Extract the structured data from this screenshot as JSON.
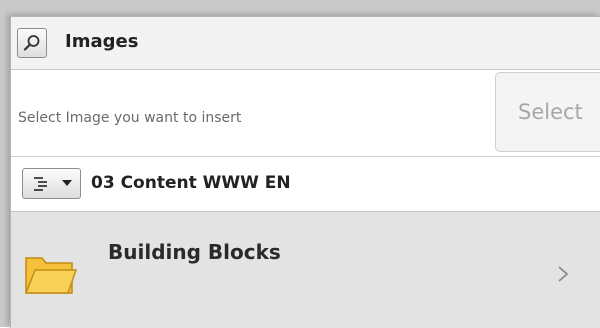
{
  "header": {
    "title": "Images",
    "search_icon": "search-icon"
  },
  "insert": {
    "hint": "Select Image you want to insert",
    "select_label": "Select"
  },
  "path": {
    "view_icon": "tree-view-icon",
    "current": "03 Content WWW EN"
  },
  "items": [
    {
      "label": "Building Blocks",
      "icon": "folder-icon",
      "action_icon": "chevron-right-icon"
    }
  ],
  "colors": {
    "folder": "#f5c03a",
    "folder_stroke": "#c28d10",
    "row_bg": "#e3e3e3",
    "disabled_text": "#a7a7a7"
  }
}
